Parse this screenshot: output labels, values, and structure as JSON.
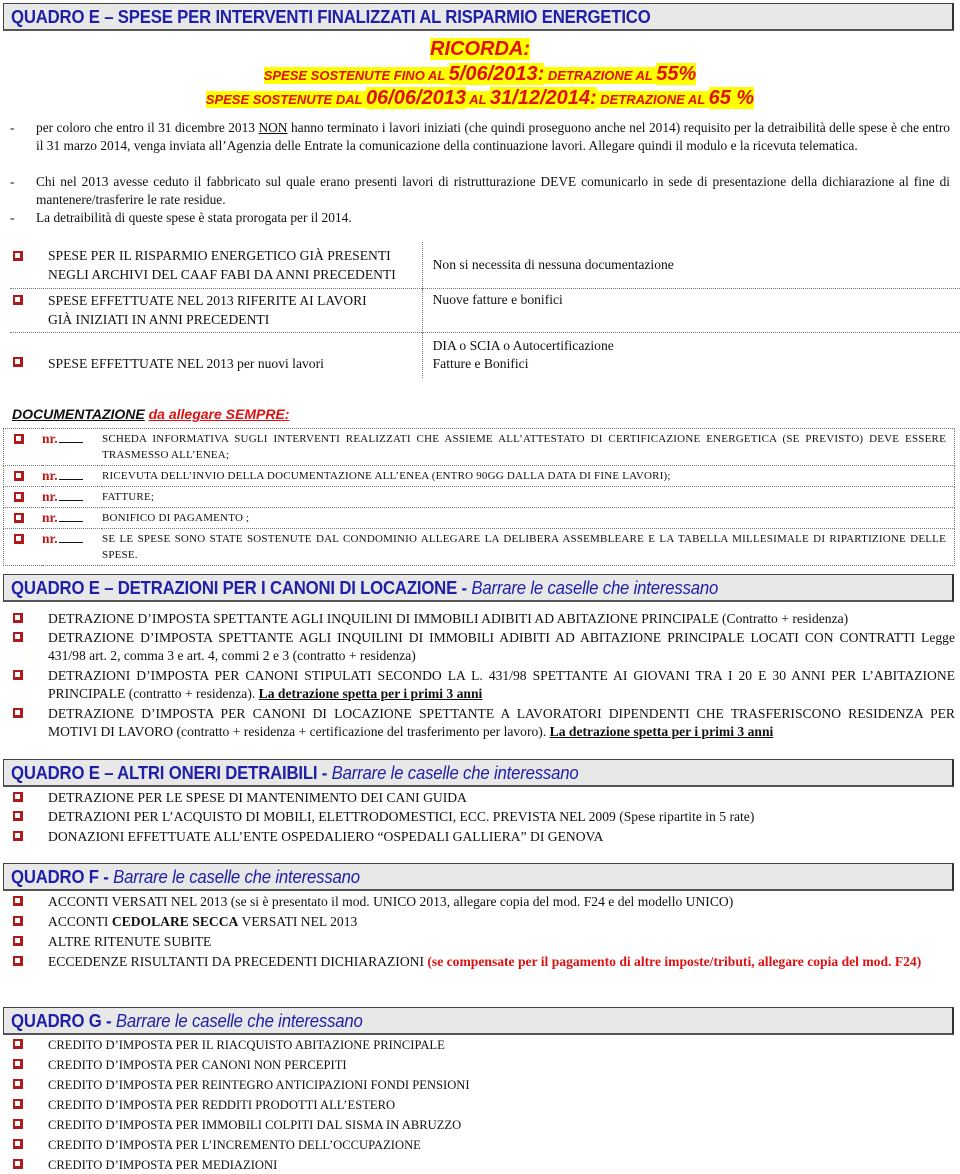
{
  "sections": {
    "quadro_e_energia": {
      "title": "QUADRO E – SPESE PER INTERVENTI FINALIZZATI AL RISPARMIO ENERGETICO"
    },
    "ricorda": {
      "label": "RICORDA:",
      "line1_pre": "SPESE SOSTENUTE FINO AL ",
      "line1_date": "5/06/2013:",
      "line1_mid": " DETRAZIONE AL ",
      "line1_pct": "55%",
      "line2_pre": "SPESE SOSTENUTE DAL ",
      "line2_date1": "06/06/2013",
      "line2_al": " AL ",
      "line2_date2": "31/12/2014:",
      "line2_mid": " DETRAZIONE AL ",
      "line2_pct": "65 %"
    },
    "notes": [
      {
        "dash": "-",
        "pre": "per coloro che entro il 31 dicembre 2013 ",
        "underlined": "NON",
        "post": " hanno terminato i lavori iniziati (che quindi proseguono anche nel 2014) requisito per la detraibilità delle spese è che entro il 31 marzo 2014, venga inviata all’Agenzia delle Entrate la comunicazione della continuazione lavori. Allegare quindi il modulo e la ricevuta telematica."
      },
      {
        "dash": "-",
        "text": "Chi nel 2013 avesse ceduto il fabbricato sul quale erano presenti lavori di ristrutturazione DEVE comunicarlo in sede di presentazione della dichiarazione al fine di mantenere/trasferire le rate residue."
      },
      {
        "dash": "-",
        "text": "La detraibilità di queste spese è stata prorogata per il 2014."
      }
    ],
    "spese_table": [
      {
        "left_l1": "SPESE PER IL RISPARMIO ENERGETICO GIÀ PRESENTI",
        "left_l2": "NEGLI ARCHIVI DEL CAAF FABI DA ANNI PRECEDENTI",
        "right_l1": "Non si necessita di nessuna documentazione",
        "right_l2": ""
      },
      {
        "left_l1": "SPESE EFFETTUATE NEL 2013 RIFERITE AI LAVORI",
        "left_l2": "GIÀ INIZIATI IN ANNI PRECEDENTI",
        "right_l1": "Nuove fatture e bonifici",
        "right_l2": ""
      },
      {
        "left_l1": "SPESE EFFETTUATE NEL 2013 per nuovi lavori",
        "left_l2": "",
        "right_l1": "DIA o SCIA o Autocertificazione",
        "right_l2": "Fatture e Bonifici"
      }
    ],
    "documentazione": {
      "title_a": "DOCUMENTAZIONE",
      "title_b": "da allegare SEMPRE",
      "title_c": ":",
      "nr_label": "nr.",
      "items": [
        "SCHEDA INFORMATIVA SUGLI INTERVENTI REALIZZATI CHE ASSIEME ALL’ATTESTATO DI CERTIFICAZIONE ENERGETICA (SE PREVISTO) DEVE ESSERE TRASMESSO ALL’ENEA;",
        "RICEVUTA DELL’INVIO DELLA DOCUMENTAZIONE ALL’ENEA (ENTRO 90GG DALLA DATA DI FINE LAVORI);",
        "FATTURE;",
        "BONIFICO DI PAGAMENTO ;",
        "SE LE SPESE SONO STATE SOSTENUTE DAL CONDOMINIO ALLEGARE LA DELIBERA ASSEMBLEARE E LA TABELLA MILLESIMALE DI RIPARTIZIONE DELLE SPESE."
      ]
    },
    "quadro_e_locazione": {
      "title": "QUADRO E – DETRAZIONI PER I CANONI DI LOCAZIONE  - ",
      "subtitle": "Barrare le caselle che  interessano",
      "items": [
        {
          "text": "DETRAZIONE D’IMPOSTA SPETTANTE AGLI INQUILINI DI IMMOBILI ADIBITI AD ABITAZIONE PRINCIPALE (Contratto + residenza)",
          "bold_ul": ""
        },
        {
          "text": "DETRAZIONE D’IMPOSTA SPETTANTE AGLI INQUILINI DI IMMOBILI ADIBITI AD ABITAZIONE PRINCIPALE LOCATI CON CONTRATTI Legge 431/98 art. 2, comma 3 e art. 4, commi 2 e 3 (contratto + residenza)",
          "bold_ul": ""
        },
        {
          "text": "DETRAZIONI D’IMPOSTA PER CANONI STIPULATI SECONDO LA L. 431/98 SPETTANTE AI GIOVANI TRA I 20 E 30 ANNI PER L’ABITAZIONE PRINCIPALE (contratto + residenza). ",
          "bold_ul": "La detrazione spetta per i primi 3 anni"
        },
        {
          "text": "DETRAZIONE D’IMPOSTA PER CANONI DI LOCAZIONE SPETTANTE A LAVORATORI DIPENDENTI CHE TRASFERISCONO RESIDENZA PER MOTIVI DI LAVORO (contratto + residenza + certificazione del trasferimento per lavoro). ",
          "bold_ul": "La detrazione spetta per i primi 3 anni"
        }
      ]
    },
    "quadro_e_altri": {
      "title": "QUADRO E – ALTRI ONERI DETRAIBILI  - ",
      "subtitle": "Barrare le caselle che  interessano",
      "items": [
        "DETRAZIONE PER LE SPESE DI MANTENIMENTO DEI CANI GUIDA",
        "DETRAZIONI  PER L’ACQUISTO DI MOBILI, ELETTRODOMESTICI, ECC. PREVISTA NEL 2009 (Spese ripartite in 5 rate)",
        "DONAZIONI EFFETTUATE ALL’ENTE OSPEDALIERO “OSPEDALI GALLIERA” DI GENOVA"
      ]
    },
    "quadro_f": {
      "title": "QUADRO F  - ",
      "subtitle": "Barrare le caselle che  interessano",
      "items": [
        {
          "pre": "ACCONTI VERSATI NEL 2013 (se si è presentato il mod. UNICO 2013, allegare copia del mod. F24 e del  modello UNICO)",
          "bold": "",
          "post": "",
          "red": ""
        },
        {
          "pre": "ACCONTI ",
          "bold": "CEDOLARE SECCA",
          "post": " VERSATI NEL 2013",
          "red": ""
        },
        {
          "pre": "ALTRE RITENUTE SUBITE",
          "bold": "",
          "post": "",
          "red": ""
        },
        {
          "pre": "ECCEDENZE RISULTANTI DA PRECEDENTI DICHIARAZIONI ",
          "bold": "",
          "post": "",
          "red": "(se compensate per il pagamento di altre imposte/tributi, allegare copia del mod. F24)"
        }
      ]
    },
    "quadro_g": {
      "title": "QUADRO G - ",
      "subtitle": "Barrare le caselle che  interessano",
      "items": [
        "CREDITO D’IMPOSTA PER IL RIACQUISTO ABITAZIONE PRINCIPALE",
        "CREDITO D’IMPOSTA PER CANONI NON PERCEPITI",
        "CREDITO D’IMPOSTA PER REINTEGRO ANTICIPAZIONI FONDI PENSIONI",
        "CREDITO D’IMPOSTA PER REDDITI PRODOTTI ALL’ESTERO",
        "CREDITO D’IMPOSTA PER IMMOBILI  COLPITI DAL SISMA IN ABRUZZO",
        "CREDITO D’IMPOSTA PER L’INCREMENTO DELL’OCCUPAZIONE",
        "CREDITO D’IMPOSTA PER MEDIAZIONI"
      ]
    }
  },
  "colors": {
    "header_text": "#1f1fa8",
    "header_bg": "#e8e8e8",
    "highlight": "#ffff00",
    "alert_red": "#dd1111",
    "checkbox": "#b01a1a"
  }
}
